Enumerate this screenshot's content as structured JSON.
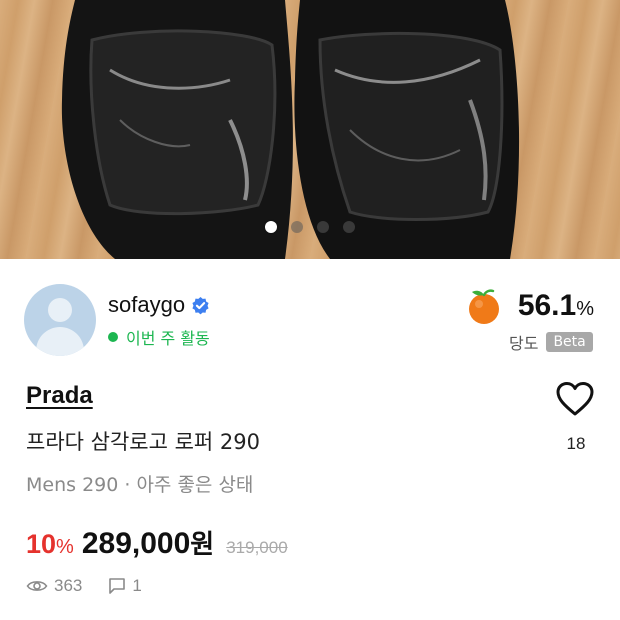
{
  "gallery": {
    "image_description": "Black leather loafers on wooden floor",
    "dot_count": 4,
    "active_index": 0
  },
  "seller": {
    "name": "sofaygo",
    "activity_status": "이번 주 활동",
    "score_value": "56.1",
    "score_unit": "%",
    "score_label": "당도",
    "beta_badge": "Beta"
  },
  "product": {
    "brand": "Prada",
    "title": "프라다 삼각로고 로퍼 290",
    "condition": "Mens 290 · 아주 좋은 상태",
    "likes": "18",
    "discount_value": "10",
    "discount_unit": "%",
    "price": "289,000",
    "currency": "원",
    "original_price": "319,000"
  },
  "stats": {
    "views": "363",
    "comments": "1"
  },
  "colors": {
    "accent_green": "#1cb650",
    "discount_red": "#e5322d",
    "verified_blue": "#3d7ff0",
    "orange": "#f07a18"
  }
}
